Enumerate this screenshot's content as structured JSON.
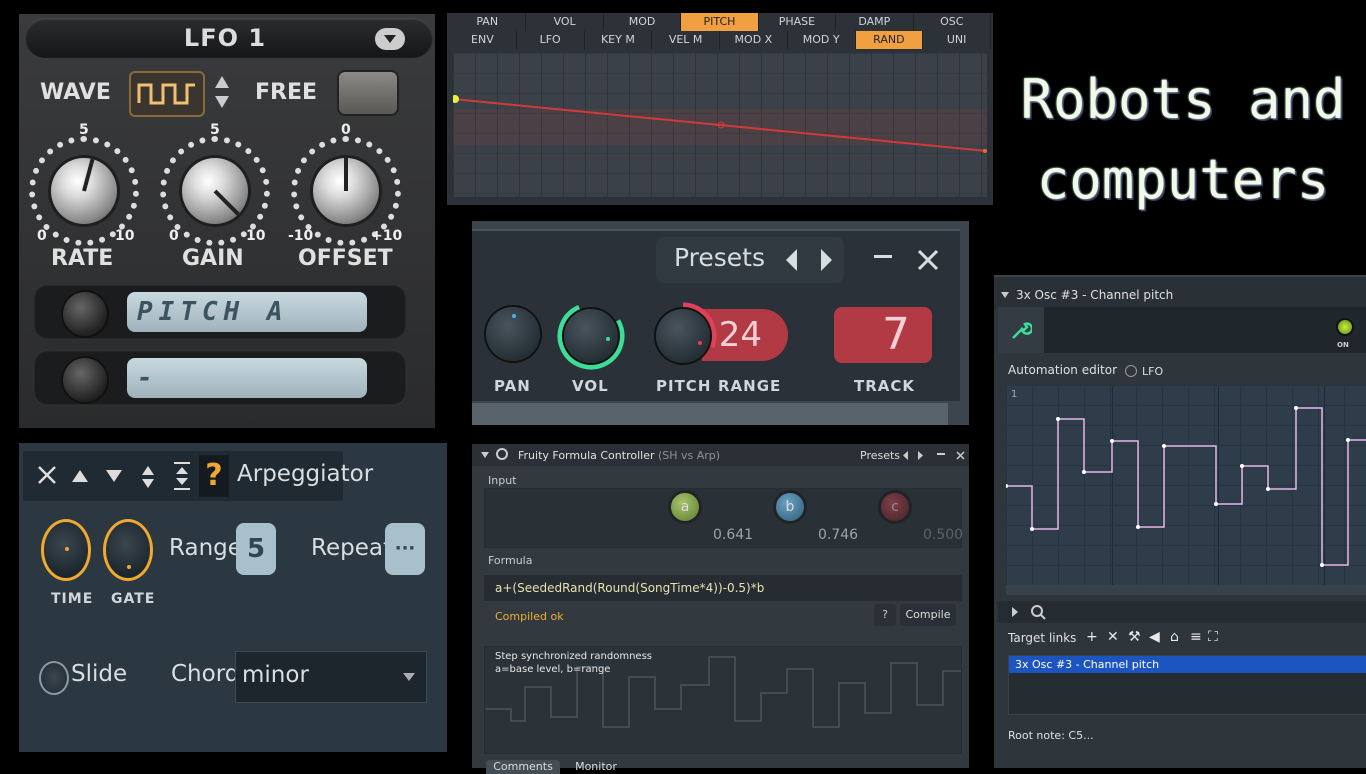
{
  "lfo": {
    "title": "LFO 1",
    "wave_label": "WAVE",
    "free_label": "FREE",
    "knobs": [
      {
        "name": "RATE",
        "top": "5",
        "min": "0",
        "max": "10"
      },
      {
        "name": "GAIN",
        "top": "5",
        "min": "0",
        "max": "10"
      },
      {
        "name": "OFFSET",
        "top": "0",
        "min": "-10",
        "max": "+10"
      }
    ],
    "target1": "PITCH A",
    "target2": "-"
  },
  "envelope": {
    "tabs_row1": [
      "PAN",
      "VOL",
      "MOD",
      "PITCH",
      "PHASE",
      "DAMP",
      "OSC"
    ],
    "tabs_row2": [
      "ENV",
      "LFO",
      "KEY M",
      "VEL M",
      "MOD X",
      "MOD Y",
      "RAND",
      "UNI"
    ],
    "selected_row1": "PITCH",
    "selected_row2": "RAND"
  },
  "banner": {
    "line1": "Robots and",
    "line2": "computers"
  },
  "presets_panel": {
    "presets_label": "Presets",
    "range_value": "24",
    "track_value": "7",
    "labels": {
      "pan": "PAN",
      "vol": "VOL",
      "pitch": "PITCH",
      "range": "RANGE",
      "track": "TRACK"
    },
    "colors": {
      "vol": "#3ddc97",
      "pitch": "#e0405a",
      "red": "#b23a44"
    }
  },
  "arp": {
    "title": "Arpeggiator",
    "time_label": "TIME",
    "gate_label": "GATE",
    "range_label": "Range",
    "range_value": "5",
    "repeat_label": "Repeat",
    "repeat_value": "···",
    "slide_label": "Slide",
    "chord_label": "Chord",
    "chord_value": "minor"
  },
  "formula": {
    "title": "Fruity Formula Controller",
    "subtitle": "(SH vs Arp)",
    "presets": "Presets",
    "input_label": "Input",
    "inputs": [
      {
        "name": "a",
        "value": "0.641"
      },
      {
        "name": "b",
        "value": "0.746"
      },
      {
        "name": "c",
        "value": "0.500"
      }
    ],
    "formula_label": "Formula",
    "formula_text": "a+(SeededRand(Round(SongTime*4))-0.5)*b",
    "status": "Compiled ok",
    "help": "?",
    "compile": "Compile",
    "comment1": "Step synchronized randomness",
    "comment2": "a=base level, b=range",
    "tab1": "Comments",
    "tab2": "Monitor"
  },
  "automation": {
    "title": "3x Osc #3 - Channel pitch",
    "on_label": "ON",
    "editor_label": "Automation editor",
    "lfo_label": "LFO",
    "grid_num": "1",
    "target_links": "Target links",
    "target_item": "3x Osc #3 - Channel pitch",
    "root_note": "Root note: C5..."
  }
}
